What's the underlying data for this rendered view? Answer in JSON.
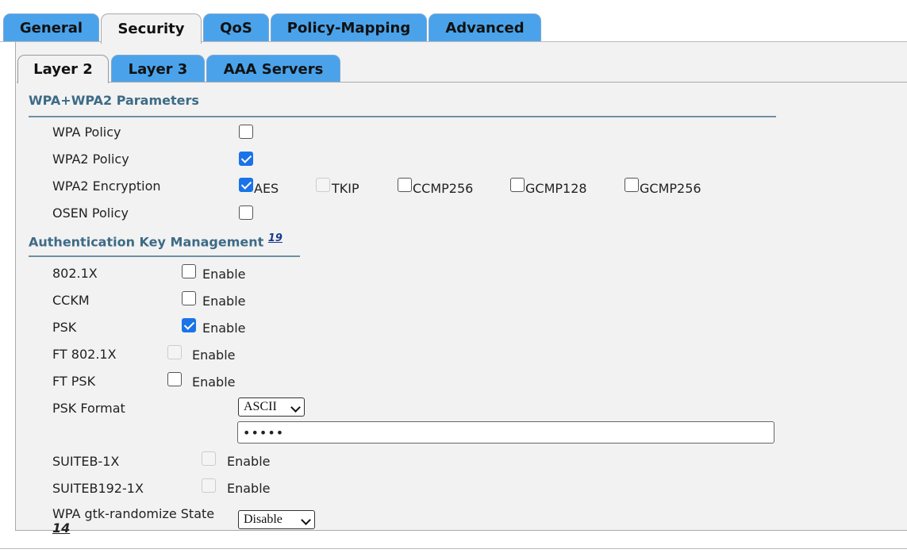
{
  "main_tabs": [
    {
      "label": "General",
      "active": false
    },
    {
      "label": "Security",
      "active": true
    },
    {
      "label": "QoS",
      "active": false
    },
    {
      "label": "Policy-Mapping",
      "active": false
    },
    {
      "label": "Advanced",
      "active": false
    }
  ],
  "sub_tabs": [
    {
      "label": "Layer 2",
      "active": true
    },
    {
      "label": "Layer 3",
      "active": false
    },
    {
      "label": "AAA Servers",
      "active": false
    }
  ],
  "wpa": {
    "title": "WPA+WPA2 Parameters",
    "wpa_policy": {
      "label": "WPA Policy",
      "checked": false
    },
    "wpa2_policy": {
      "label": "WPA2 Policy",
      "checked": true
    },
    "wpa2_encryption": {
      "label": "WPA2 Encryption",
      "options": [
        {
          "label": "AES",
          "checked": true,
          "disabled": false
        },
        {
          "label": "TKIP",
          "checked": false,
          "disabled": true
        },
        {
          "label": "CCMP256",
          "checked": false,
          "disabled": false
        },
        {
          "label": "GCMP128",
          "checked": false,
          "disabled": false
        },
        {
          "label": "GCMP256",
          "checked": false,
          "disabled": false
        }
      ]
    },
    "osen_policy": {
      "label": "OSEN Policy",
      "checked": false
    }
  },
  "akm": {
    "title": "Authentication Key Management",
    "footnote": "19",
    "enable_label": "Enable",
    "rows": [
      {
        "label": "802.1X",
        "checked": false,
        "disabled": false
      },
      {
        "label": "CCKM",
        "checked": false,
        "disabled": false
      },
      {
        "label": "PSK",
        "checked": true,
        "disabled": false
      },
      {
        "label": "FT 802.1X",
        "checked": false,
        "disabled": true
      },
      {
        "label": "FT PSK",
        "checked": false,
        "disabled": false
      }
    ],
    "psk_format": {
      "label": "PSK Format",
      "value": "ASCII"
    },
    "psk_value": "•••••",
    "suiteb_rows": [
      {
        "label": "SUITEB-1X",
        "checked": false,
        "disabled": true
      },
      {
        "label": "SUITEB192-1X",
        "checked": false,
        "disabled": true
      }
    ],
    "gtk": {
      "label": "WPA gtk-randomize State",
      "footnote": "14",
      "value": "Disable"
    }
  }
}
